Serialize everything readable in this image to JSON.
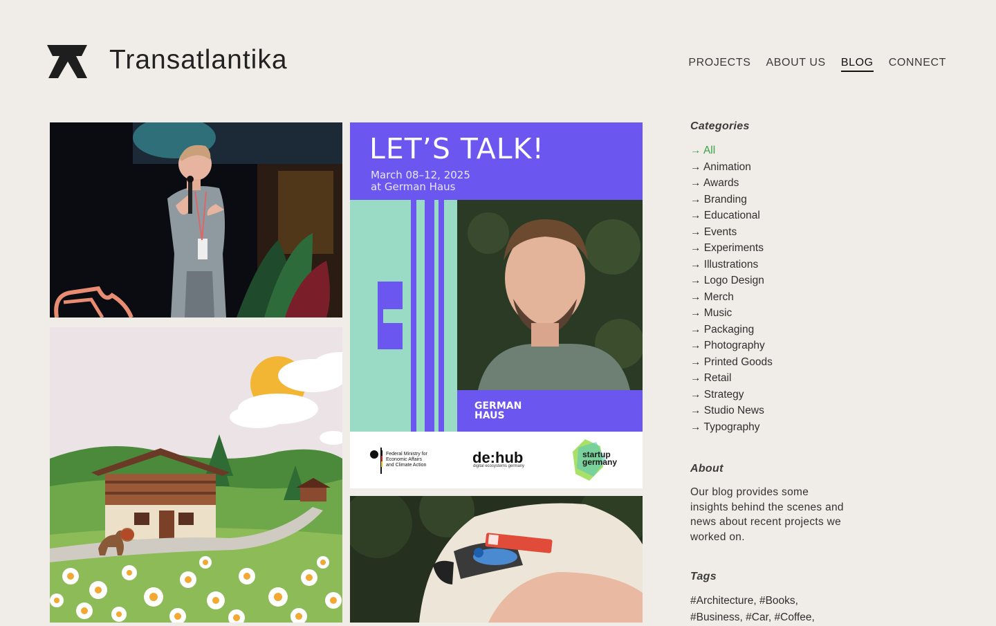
{
  "brand": {
    "name": "Transatlantika",
    "logo_icon": "k-arrow-logo-icon"
  },
  "nav": [
    {
      "label": "PROJECTS"
    },
    {
      "label": "ABOUT US"
    },
    {
      "label": "BLOG",
      "active": true
    },
    {
      "label": "CONNECT"
    }
  ],
  "posts": {
    "event": {
      "title": "LET’S TALK!",
      "date": "March 08–12, 2025",
      "venue": "at German Haus",
      "brand_line1": "GERMAN",
      "brand_line2": "HAUS",
      "partner1": "Federal Ministry for Economic Affairs and Climate Action",
      "partner2": "de:hub",
      "partner2_sub": "digital ecosystems germany",
      "partner3_line1": "startup",
      "partner3_line2": "germany"
    }
  },
  "sidebar": {
    "categories_title": "Categories",
    "categories": [
      {
        "label": "→ All",
        "active": true
      },
      {
        "label": "→ Animation"
      },
      {
        "label": "→ Awards"
      },
      {
        "label": "→ Branding"
      },
      {
        "label": "→ Educational"
      },
      {
        "label": "→ Events"
      },
      {
        "label": "→ Experiments"
      },
      {
        "label": "→ Illustrations"
      },
      {
        "label": "→ Logo Design"
      },
      {
        "label": "→ Merch"
      },
      {
        "label": "→ Music"
      },
      {
        "label": "→ Packaging"
      },
      {
        "label": "→ Photography"
      },
      {
        "label": "→ Printed Goods"
      },
      {
        "label": "→ Retail"
      },
      {
        "label": "→ Strategy"
      },
      {
        "label": "→ Studio News"
      },
      {
        "label": "→ Typography"
      }
    ],
    "about_title": "About",
    "about_text": "Our blog provides some insights behind the scenes and news about recent projects we worked on.",
    "tags_title": "Tags",
    "tags": [
      "#Architecture,",
      "#Books,",
      "#Business,",
      "#Car,",
      "#Coffee,"
    ]
  },
  "colors": {
    "background": "#f0ece7",
    "accent_green": "#3aa14a",
    "poster_purple": "#6b57f0",
    "poster_mint": "#9adbc6"
  }
}
